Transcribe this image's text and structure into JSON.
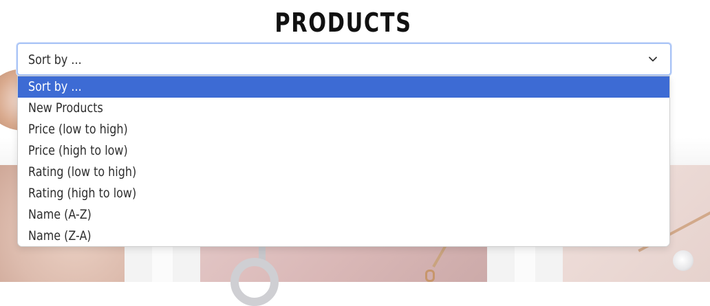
{
  "page": {
    "title": "PRODUCTS"
  },
  "sort": {
    "value": "Sort by ...",
    "options": [
      "Sort by ...",
      "New Products",
      "Price (low to high)",
      "Price (high to low)",
      "Rating (low to high)",
      "Rating (high to low)",
      "Name (A-Z)",
      "Name (Z-A)"
    ],
    "selected_index": 0,
    "highlight_color": "#3d6bd4",
    "focus_color": "#a9c4f6"
  },
  "icons": {
    "expand": "chevron-down-icon"
  }
}
